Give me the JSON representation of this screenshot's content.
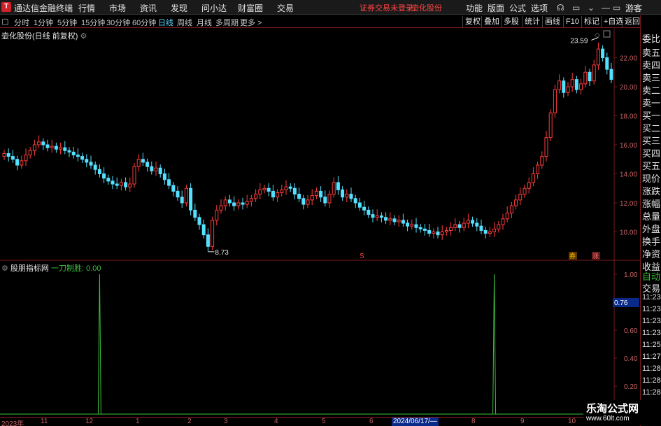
{
  "window": {
    "logo_char": "T",
    "title": "通达信金融终端",
    "menus": [
      "行情",
      "市场",
      "资讯",
      "发现",
      "问小达",
      "财富圈",
      "交易"
    ],
    "status_msg": "证券交易未登录",
    "stock_name_top": "壶化股份",
    "right_menus": [
      "功能",
      "版面",
      "公式",
      "选项"
    ],
    "guest": "游客"
  },
  "toolbar": {
    "periods": [
      "分时",
      "1分钟",
      "5分钟",
      "15分钟",
      "30分钟",
      "60分钟",
      "日线",
      "周线",
      "月线",
      "多周期",
      "更多 >"
    ],
    "active_period": "日线",
    "buttons": [
      "复权",
      "叠加",
      "多股",
      "统计",
      "画线",
      "F10",
      "标记",
      "+自选",
      "返回"
    ]
  },
  "main_chart": {
    "title": "壶化股份(日线 前复权)",
    "high_label": "23.59",
    "low_label": "8.73",
    "y_ticks": [
      "22.00",
      "20.00",
      "18.00",
      "16.00",
      "14.00",
      "12.00",
      "10.00"
    ],
    "markers": [
      "S",
      "券",
      "涨"
    ]
  },
  "indicator": {
    "name": "股朋指标网",
    "line_label": "一刀制胜: 0.00",
    "cursor_value": "0.76",
    "y_ticks": [
      "1.00",
      "0.80",
      "0.60",
      "0.40",
      "0.20"
    ]
  },
  "xaxis": {
    "labels": [
      "2023年",
      "11",
      "12",
      "1",
      "2",
      "3",
      "4",
      "5",
      "6",
      "7",
      "8",
      "9",
      "10"
    ],
    "cursor_date": "2024/06/17/—"
  },
  "right_panel": {
    "items": [
      "委比",
      "卖五",
      "卖四",
      "卖三",
      "卖二",
      "卖一",
      "买一",
      "买二",
      "买三",
      "买四",
      "买五",
      "现价",
      "涨跌",
      "涨幅",
      "总量",
      "外盘",
      "换手",
      "净资",
      "收益"
    ],
    "auto": "自动",
    "trade": "交易",
    "times": [
      "11:23",
      "11:23",
      "11:23",
      "11:23",
      "11:25",
      "11:27",
      "11:28",
      "11:28",
      "11:28"
    ]
  },
  "watermark": {
    "main": "乐淘公式网",
    "sub": "www.60lt.com"
  },
  "chart_data": {
    "type": "candlestick",
    "price_range": [
      8.0,
      24.0
    ],
    "closes": [
      15.4,
      15.2,
      15.0,
      14.6,
      14.9,
      15.3,
      15.6,
      16.0,
      16.2,
      16.0,
      15.8,
      15.9,
      15.7,
      15.8,
      15.6,
      15.5,
      15.3,
      15.2,
      15.0,
      14.8,
      14.6,
      14.3,
      14.0,
      13.7,
      13.5,
      13.3,
      13.2,
      13.4,
      13.1,
      13.3,
      14.5,
      15.0,
      14.8,
      14.5,
      14.2,
      14.4,
      14.0,
      13.6,
      13.2,
      12.8,
      12.4,
      12.0,
      13.0,
      11.5,
      11.0,
      10.5,
      9.8,
      9.0,
      10.8,
      11.5,
      11.8,
      12.2,
      12.0,
      11.8,
      12.0,
      11.9,
      12.1,
      12.3,
      12.6,
      12.9,
      13.0,
      12.8,
      12.4,
      12.7,
      12.9,
      13.1,
      13.0,
      12.6,
      12.3,
      11.9,
      12.2,
      12.5,
      12.8,
      12.4,
      12.0,
      12.6,
      13.4,
      12.9,
      12.4,
      12.6,
      12.3,
      12.0,
      11.7,
      11.5,
      11.2,
      11.0,
      11.1,
      11.0,
      10.8,
      10.9,
      10.7,
      10.8,
      10.6,
      10.4,
      10.5,
      10.3,
      10.2,
      10.1,
      9.9,
      10.0,
      9.8,
      10.0,
      10.1,
      10.3,
      10.5,
      10.3,
      10.6,
      10.8,
      10.6,
      10.4,
      10.1,
      9.9,
      10.0,
      10.2,
      10.5,
      10.9,
      11.3,
      11.8,
      12.2,
      12.6,
      13.0,
      13.4,
      14.0,
      14.6,
      15.2,
      16.5,
      18.2,
      19.8,
      20.4,
      19.6,
      20.0,
      20.5,
      19.8,
      20.2,
      21.0,
      20.4,
      21.5,
      22.6,
      22.0,
      21.2,
      20.5
    ],
    "indicator_spikes": [
      22,
      113
    ],
    "indicator_range": [
      0,
      1.0
    ]
  }
}
